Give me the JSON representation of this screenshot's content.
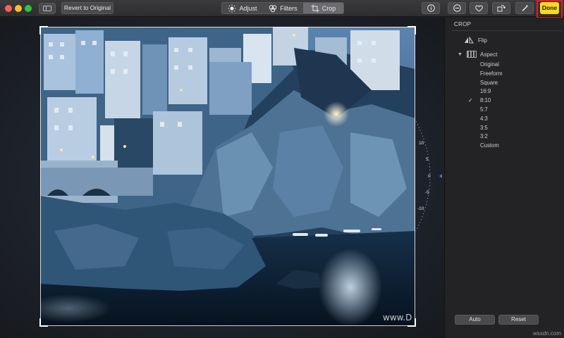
{
  "toolbar": {
    "revert_label": "Revert to Original",
    "modes": [
      {
        "label": "Adjust",
        "icon": "sun-icon"
      },
      {
        "label": "Filters",
        "icon": "filters-icon"
      },
      {
        "label": "Crop",
        "icon": "crop-icon",
        "selected": true
      }
    ],
    "tools": [
      "info-icon",
      "minus-circle-icon",
      "heart-icon",
      "rotate-icon",
      "magic-wand-icon"
    ],
    "done_label": "Done",
    "done_color": "#f8d91c",
    "highlight_color": "#e01e1e"
  },
  "canvas": {
    "watermark": "www.D",
    "dial_labels": [
      "10",
      "5",
      "0",
      "-5",
      "-10"
    ]
  },
  "sidebar": {
    "title": "CROP",
    "flip_label": "Flip",
    "aspect_label": "Aspect",
    "aspect_options": [
      {
        "label": "Original",
        "checked": false
      },
      {
        "label": "Freeform",
        "checked": false
      },
      {
        "label": "Square",
        "checked": false
      },
      {
        "label": "16:9",
        "checked": false
      },
      {
        "label": "8:10",
        "checked": true
      },
      {
        "label": "5:7",
        "checked": false
      },
      {
        "label": "4:3",
        "checked": false
      },
      {
        "label": "3:5",
        "checked": false
      },
      {
        "label": "3:2",
        "checked": false
      },
      {
        "label": "Custom",
        "checked": false
      }
    ],
    "auto_label": "Auto",
    "reset_label": "Reset",
    "corner_text": "wsxdn.com"
  }
}
